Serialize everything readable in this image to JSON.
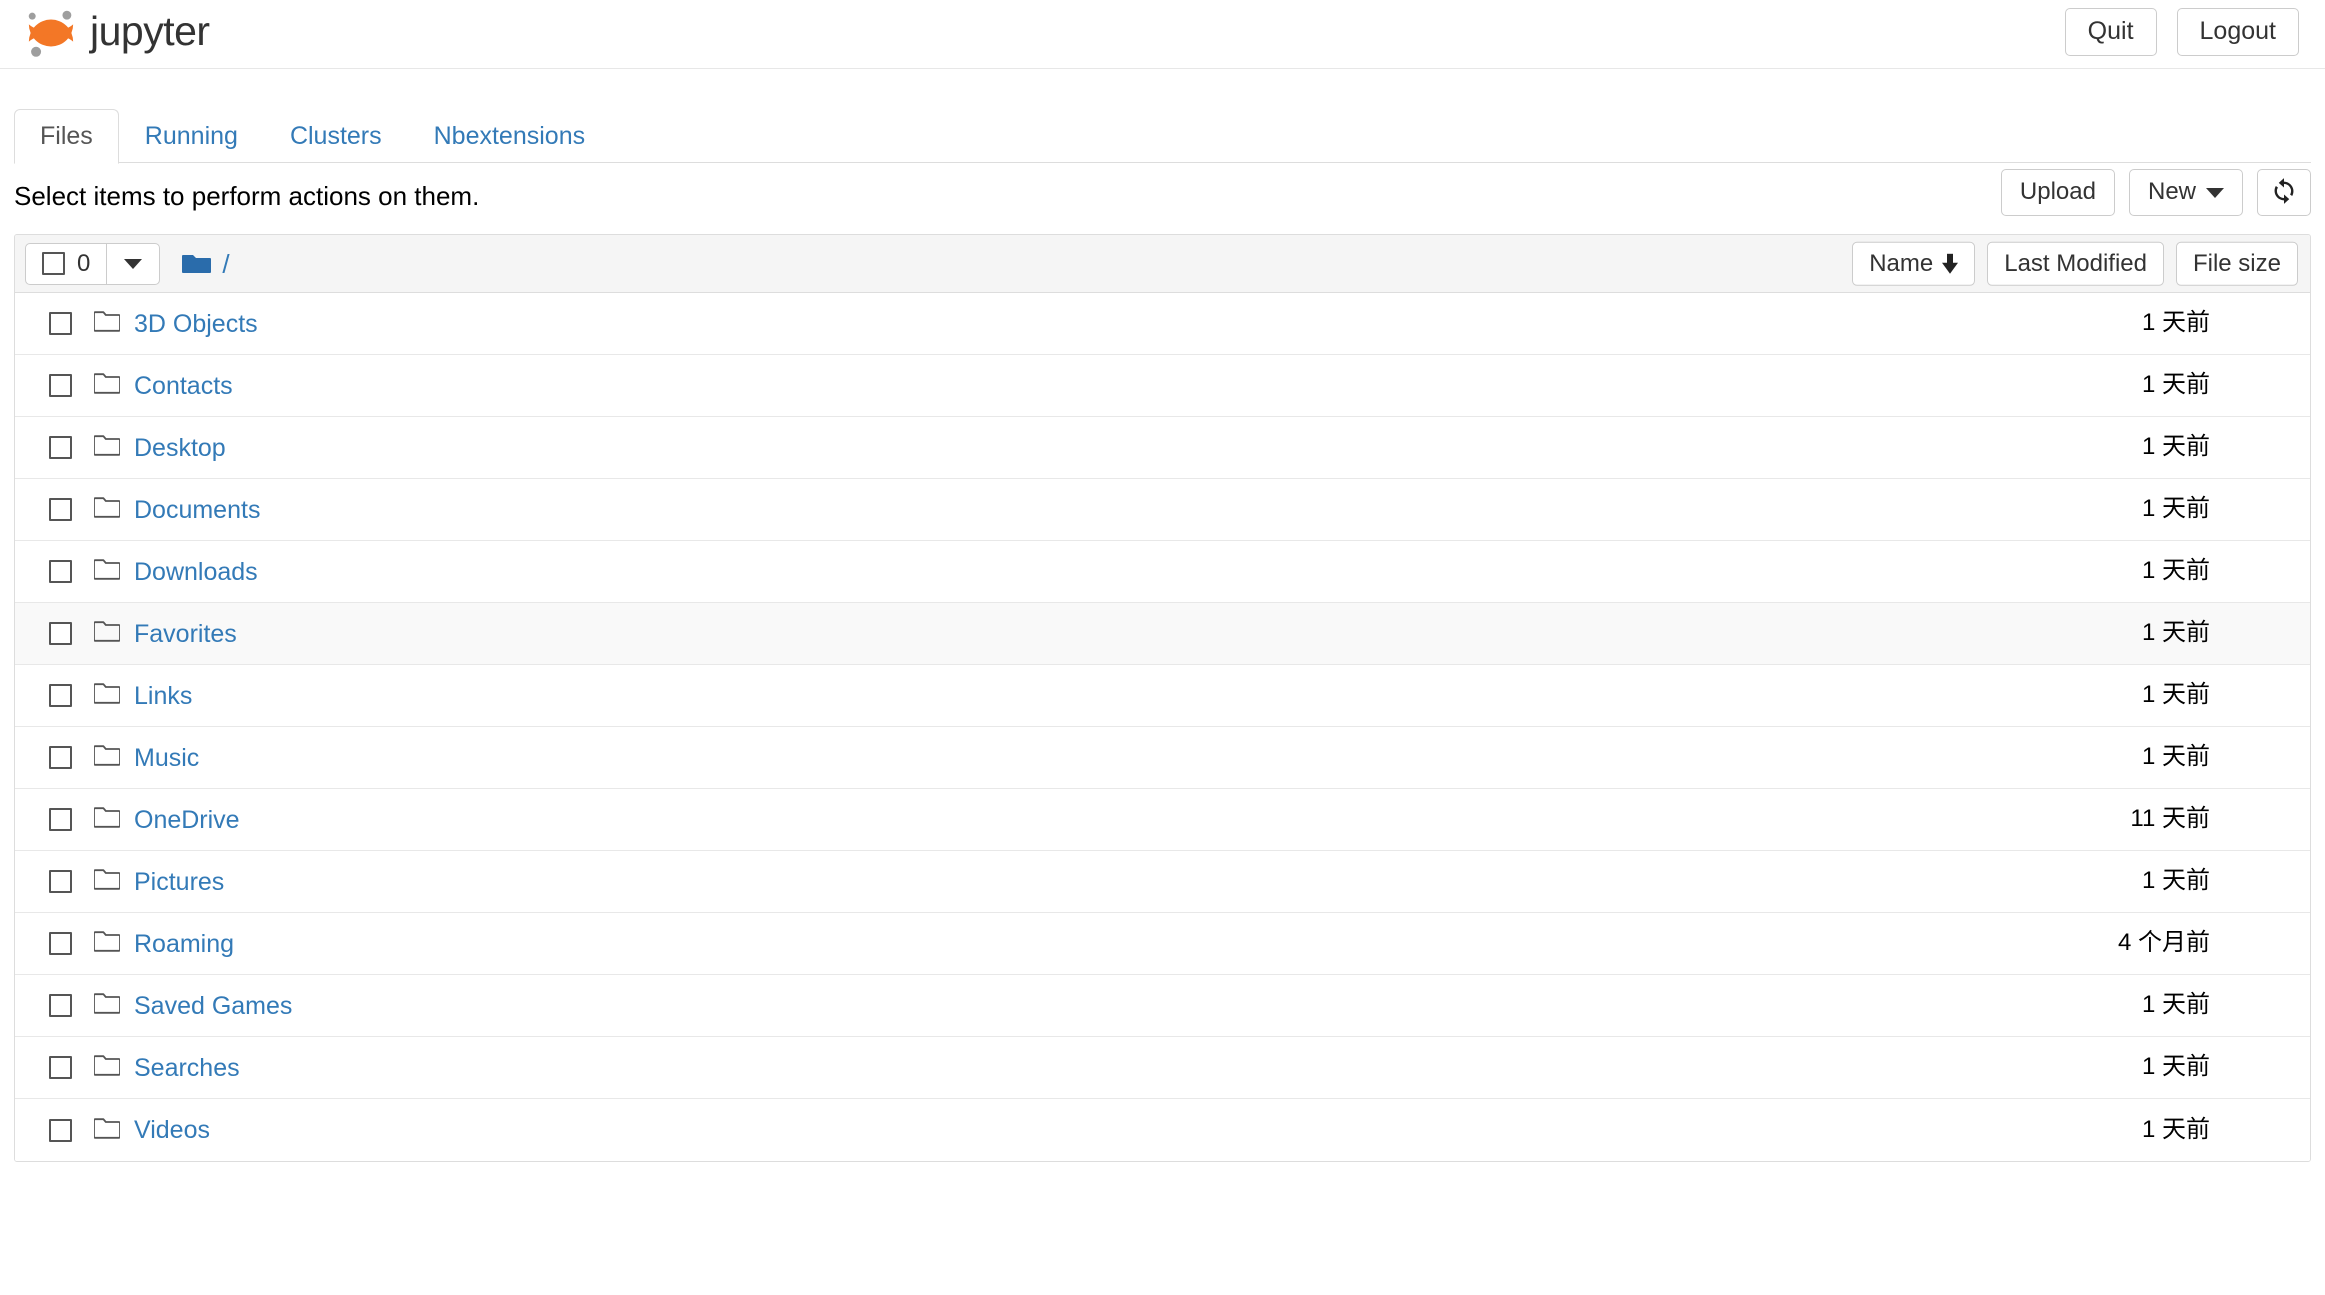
{
  "header": {
    "brand_text": "jupyter",
    "logo_icon": "jupyter-logo",
    "quit_label": "Quit",
    "logout_label": "Logout"
  },
  "tabs": [
    {
      "label": "Files",
      "active": true
    },
    {
      "label": "Running",
      "active": false
    },
    {
      "label": "Clusters",
      "active": false
    },
    {
      "label": "Nbextensions",
      "active": false
    }
  ],
  "notification": {
    "text": "Select items to perform actions on them.",
    "upload_label": "Upload",
    "new_label": "New",
    "new_caret_icon": "chevron-down-icon",
    "refresh_icon": "refresh-icon"
  },
  "list_header": {
    "selected_count": "0",
    "select_all_checkbox": "checkbox-unchecked",
    "select_caret_icon": "chevron-down-icon",
    "breadcrumb_folder_icon": "folder-solid-icon",
    "breadcrumb_path": "/",
    "sort_name": "Name",
    "sort_name_arrow_icon": "arrow-down-icon",
    "sort_last_modified": "Last Modified",
    "sort_file_size": "File size"
  },
  "files": [
    {
      "name": "3D Objects",
      "icon": "folder-icon",
      "modified": "1 天前",
      "hover": false
    },
    {
      "name": "Contacts",
      "icon": "folder-icon",
      "modified": "1 天前",
      "hover": false
    },
    {
      "name": "Desktop",
      "icon": "folder-icon",
      "modified": "1 天前",
      "hover": false
    },
    {
      "name": "Documents",
      "icon": "folder-icon",
      "modified": "1 天前",
      "hover": false
    },
    {
      "name": "Downloads",
      "icon": "folder-icon",
      "modified": "1 天前",
      "hover": false
    },
    {
      "name": "Favorites",
      "icon": "folder-icon",
      "modified": "1 天前",
      "hover": true
    },
    {
      "name": "Links",
      "icon": "folder-icon",
      "modified": "1 天前",
      "hover": false
    },
    {
      "name": "Music",
      "icon": "folder-icon",
      "modified": "1 天前",
      "hover": false
    },
    {
      "name": "OneDrive",
      "icon": "folder-icon",
      "modified": "11 天前",
      "hover": false
    },
    {
      "name": "Pictures",
      "icon": "folder-icon",
      "modified": "1 天前",
      "hover": false
    },
    {
      "name": "Roaming",
      "icon": "folder-icon",
      "modified": "4 个月前",
      "hover": false
    },
    {
      "name": "Saved Games",
      "icon": "folder-icon",
      "modified": "1 天前",
      "hover": false
    },
    {
      "name": "Searches",
      "icon": "folder-icon",
      "modified": "1 天前",
      "hover": false
    },
    {
      "name": "Videos",
      "icon": "folder-icon",
      "modified": "1 天前",
      "hover": false
    }
  ],
  "colors": {
    "link": "#337ab7",
    "logo_orange": "#f37726",
    "logo_gray": "#9e9e9e",
    "folder_blue": "#2a6cab",
    "border": "#dddddd",
    "header_bg": "#f5f5f5"
  }
}
